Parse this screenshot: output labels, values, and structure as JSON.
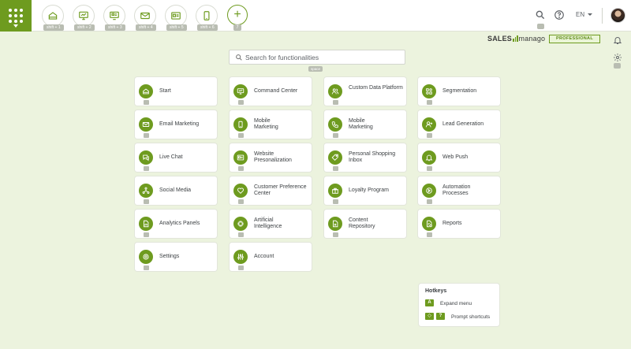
{
  "topbar": {
    "shortcuts": [
      {
        "name": "start",
        "hint": "shift + 1",
        "icon": "home-icon"
      },
      {
        "name": "command-center",
        "hint": "shift + 2",
        "icon": "monitor-icon"
      },
      {
        "name": "website-personalization",
        "hint": "shift + 3",
        "icon": "website-icon"
      },
      {
        "name": "email-marketing",
        "hint": "shift + 4",
        "icon": "envelope-icon"
      },
      {
        "name": "personal-shopping-inbox",
        "hint": "shift + 5",
        "icon": "id-card-icon"
      },
      {
        "name": "mobile-marketing",
        "hint": "shift + 6",
        "icon": "phone-icon"
      }
    ],
    "add_symbol": "+",
    "add_hint": "7",
    "language": "EN"
  },
  "brand": {
    "name_bold": "SALES",
    "name_light": "manago",
    "plan": "PROFESSIONAL"
  },
  "search": {
    "placeholder": "Search for functionalities",
    "hint": "space"
  },
  "tiles": [
    {
      "label": "Start",
      "icon": "home-icon"
    },
    {
      "label": "Command Center",
      "icon": "monitor-icon"
    },
    {
      "label": "Custom Data Platform",
      "icon": "users-icon"
    },
    {
      "label": "Segmentation",
      "icon": "segments-icon"
    },
    {
      "label": "Email Marketing",
      "icon": "envelope-icon"
    },
    {
      "label": "Mobile Marketing",
      "icon": "phone-icon"
    },
    {
      "label": "Mobile Marketing",
      "icon": "call-icon"
    },
    {
      "label": "Lead Generation",
      "icon": "user-plus-icon"
    },
    {
      "label": "Live Chat",
      "icon": "chat-icon"
    },
    {
      "label": "Website Presonalization",
      "icon": "website-icon"
    },
    {
      "label": "Personal Shopping Inbox",
      "icon": "tag-icon"
    },
    {
      "label": "Web Push",
      "icon": "bell-icon"
    },
    {
      "label": "Social Media",
      "icon": "network-icon"
    },
    {
      "label": "Customer Preference Center",
      "icon": "heart-icon"
    },
    {
      "label": "Loyalty Program",
      "icon": "gift-icon"
    },
    {
      "label": "Automation Processes",
      "icon": "automation-icon"
    },
    {
      "label": "Analytics Panels",
      "icon": "analytics-icon"
    },
    {
      "label": "Artificial Intelligence",
      "icon": "chip-icon"
    },
    {
      "label": "Content Repository",
      "icon": "file-icon"
    },
    {
      "label": "Reports",
      "icon": "report-icon"
    },
    {
      "label": "Settings",
      "icon": "gear-icon"
    },
    {
      "label": "Account",
      "icon": "sliders-icon"
    }
  ],
  "hotkeys": {
    "title": "Hotkeys",
    "items": [
      {
        "keys": [
          "A"
        ],
        "label": "Expand menu"
      },
      {
        "keys": [
          "◇",
          "?"
        ],
        "label": "Prompt shortcuts"
      }
    ]
  },
  "colors": {
    "accent": "#6e9b1f",
    "background": "#ecf3de",
    "tile": "#ffffff",
    "key_hint": "#b9bdb2"
  }
}
